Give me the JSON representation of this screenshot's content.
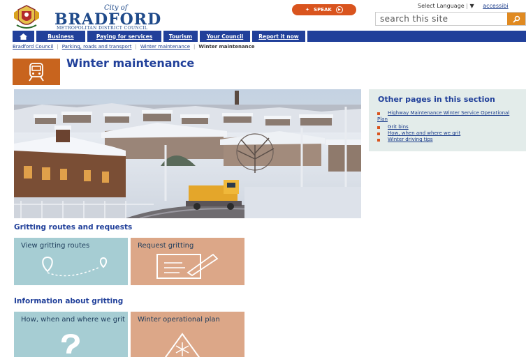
{
  "header": {
    "logo_city": "City of",
    "logo_name": "BRADFORD",
    "logo_sub": "METROPOLITAN DISTRICT COUNCIL",
    "speak_label": "SPEAK",
    "select_language": "Select Language",
    "accessibility": "accessibi",
    "search_placeholder": "search this site"
  },
  "nav": {
    "items": [
      "Business",
      "Paying for services",
      "Tourism",
      "Your Council",
      "Report it now"
    ]
  },
  "breadcrumb": {
    "items": [
      "Bradford Council",
      "Parking, roads and transport",
      "Winter maintenance"
    ],
    "current": "Winter maintenance"
  },
  "page": {
    "title": "Winter maintenance"
  },
  "sidebar": {
    "heading": "Other pages in this section",
    "links": [
      "Highway Maintenance Winter Service Operational Plan",
      "Grit bins",
      "How, when and where we grit",
      "Winter driving tips"
    ]
  },
  "sections": [
    {
      "heading": "Gritting routes and requests",
      "tiles": [
        {
          "label": "View gritting routes",
          "icon": "route-pin-icon"
        },
        {
          "label": "Request gritting",
          "icon": "form-pen-icon"
        }
      ]
    },
    {
      "heading": "Information about gritting",
      "tiles": [
        {
          "label": "How, when and where we grit",
          "icon": "question-mark-icon"
        },
        {
          "label": "Winter operational plan",
          "icon": "snow-warning-icon"
        }
      ]
    }
  ],
  "colors": {
    "nav_blue": "#21409a",
    "accent_orange": "#d9541e",
    "tile_blue": "#a6cdd3",
    "tile_tan": "#dca788"
  }
}
